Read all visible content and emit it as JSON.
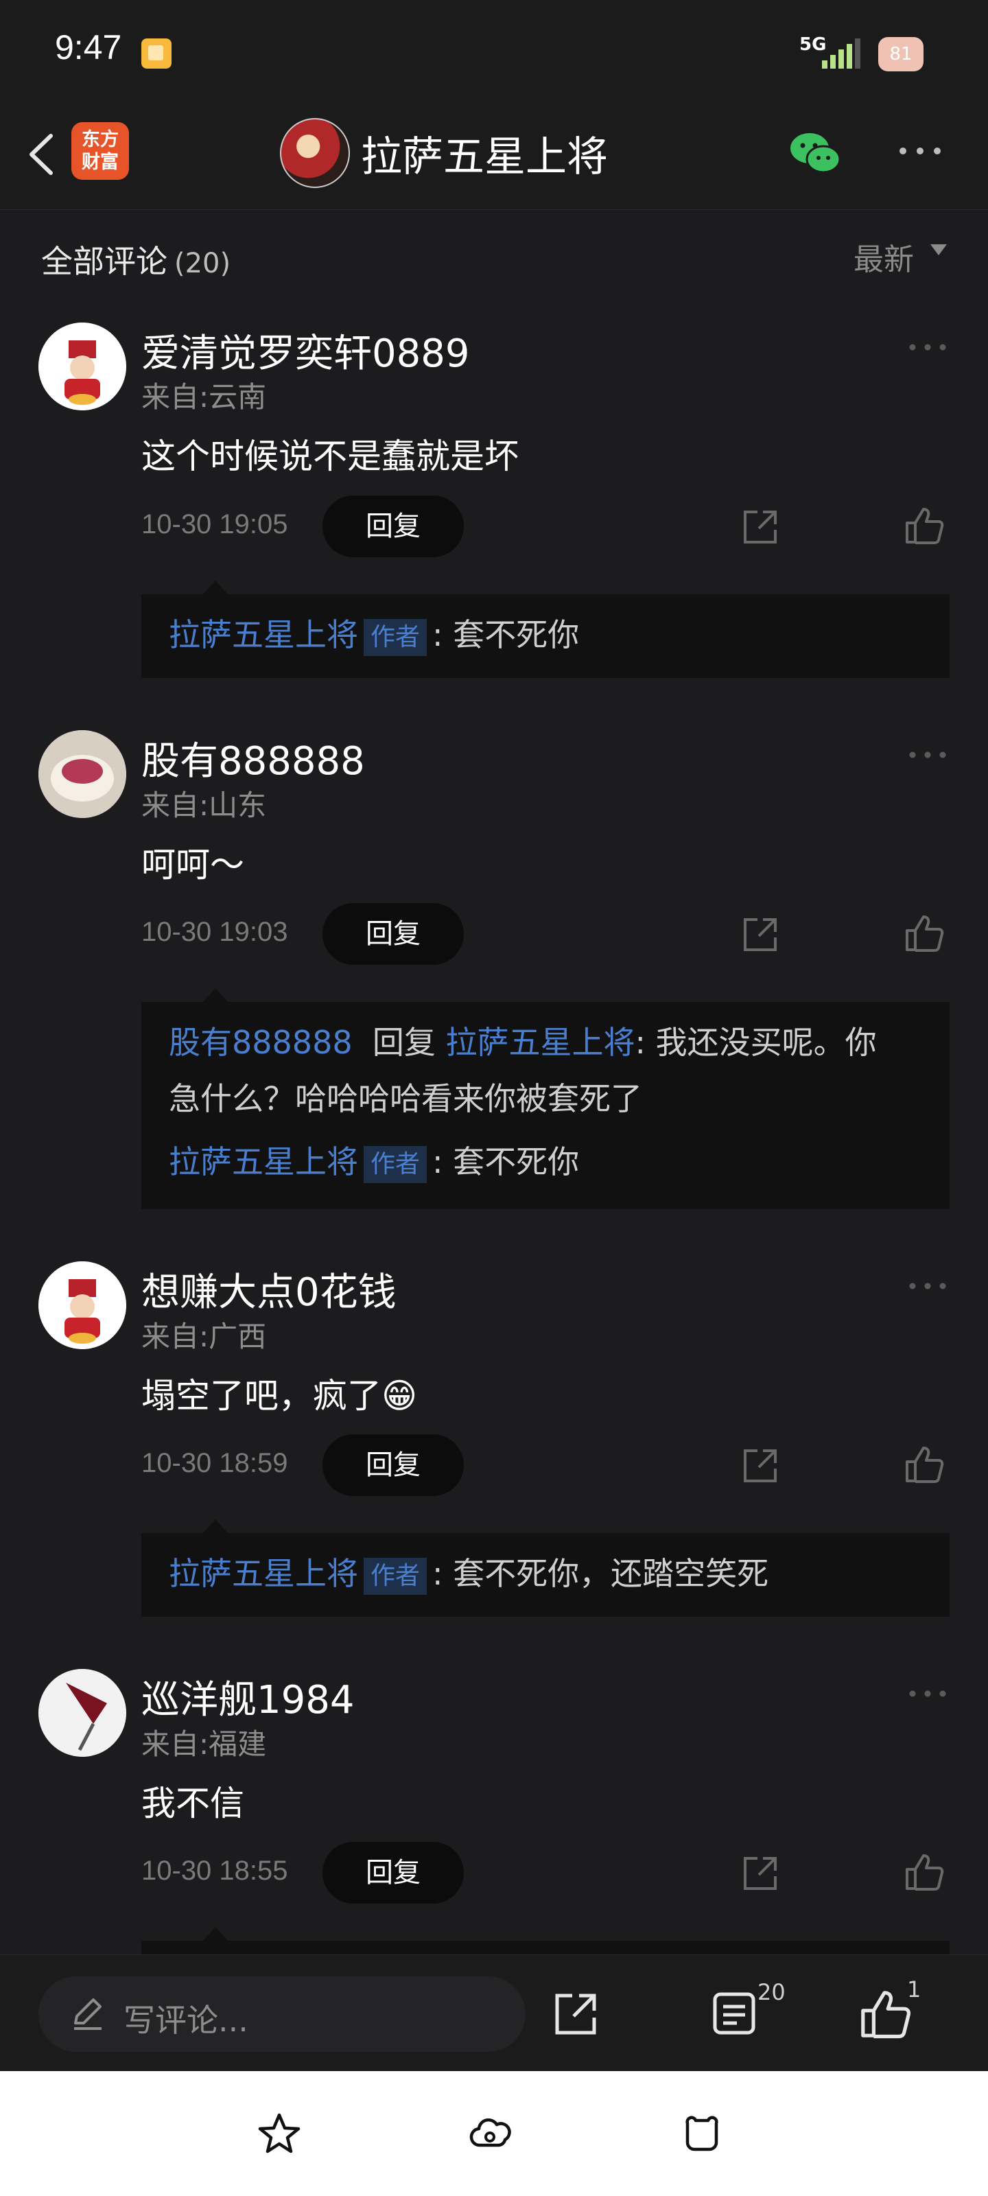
{
  "status_bar": {
    "time": "9:47",
    "network": "5G",
    "battery": "81"
  },
  "header": {
    "app_logo_line1": "东方",
    "app_logo_line2": "财富",
    "title": "拉萨五星上将"
  },
  "subheader": {
    "title": "全部评论",
    "count": "(20)",
    "sort": "最新"
  },
  "reply_label": "回复",
  "author_tag": "作者",
  "comments": [
    {
      "name": "爱清觉罗奕轩0889",
      "location": "来自:云南",
      "content": "这个时候说不是蠢就是坏",
      "time": "10-30 19:05",
      "reply": {
        "name": "拉萨五星上将",
        "text": ": 套不死你"
      }
    },
    {
      "name": "股有888888",
      "location": "来自:山东",
      "content": "呵呵～",
      "time": "10-30 19:03",
      "thread": {
        "from": "股有888888",
        "verb": "回复",
        "to": "拉萨五星上将",
        "text_line1": ": 我还没买呢。你",
        "text_line2": "急什么？哈哈哈哈看来你被套死了"
      },
      "reply": {
        "name": "拉萨五星上将",
        "text": ": 套不死你"
      }
    },
    {
      "name": "想赚大点0花钱",
      "location": "来自:广西",
      "content": "塌空了吧，疯了😁",
      "time": "10-30 18:59",
      "reply": {
        "name": "拉萨五星上将",
        "text": ": 套不死你，还踏空笑死"
      }
    },
    {
      "name": "巡洋舰1984",
      "location": "来自:福建",
      "content": "我不信",
      "time": "10-30 18:55"
    }
  ],
  "bottom_bar": {
    "placeholder": "写评论...",
    "comment_count": "20",
    "like_count": "1"
  }
}
